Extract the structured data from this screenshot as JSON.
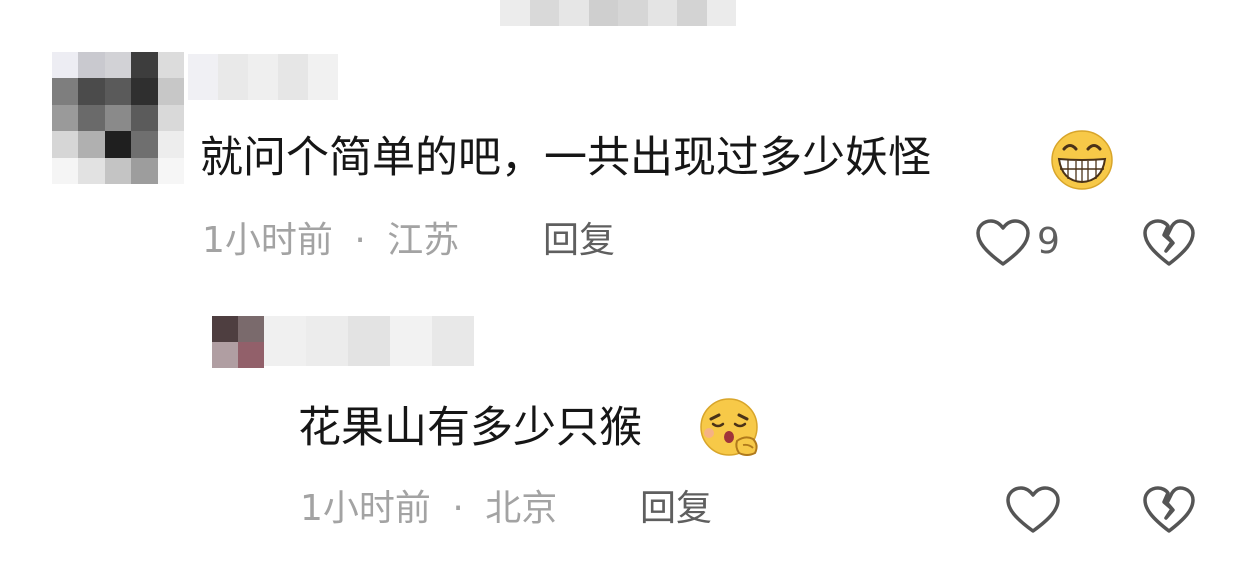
{
  "top_blurred_text": {
    "colors": [
      "#ececec",
      "#d9d9d9",
      "#e6e6e6",
      "#cfcfcf",
      "#d6d6d6",
      "#e4e4e4",
      "#d3d3d3",
      "#ebebeb"
    ]
  },
  "comment": {
    "avatar": {
      "colors": [
        "#ededf3",
        "#c9c9cf",
        "#d2d2d6",
        "#3d3d3d",
        "#dcdcdc",
        "#7e7e7e",
        "#4b4b4b",
        "#5a5a5a",
        "#2f2f2f",
        "#c7c7c7",
        "#9a9a9a",
        "#6a6a6a",
        "#8a8a8a",
        "#5b5b5b",
        "#d9d9d9",
        "#d6d6d6",
        "#b0b0b0",
        "#1f1f1f",
        "#6f6f6f",
        "#ededed",
        "#f5f5f5",
        "#e2e2e2",
        "#c4c4c4",
        "#9d9d9d",
        "#f6f6f6"
      ]
    },
    "username_blur": {
      "colors": [
        "#f0f0f4",
        "#e9e9e9",
        "#efefef",
        "#e6e6e6",
        "#f1f1f1"
      ]
    },
    "text": "就问个简单的吧，一共出现过多少妖怪",
    "emoji": "grinning-face-emoji",
    "time": "1小时前",
    "separator": "·",
    "location": "江苏",
    "reply_label": "回复",
    "like_count": "9"
  },
  "reply": {
    "avatar": {
      "colors": [
        "#4e3e40",
        "#7a6a6c",
        "#b09ea2",
        "#92606a"
      ]
    },
    "username_blur": {
      "colors": [
        "#f0f0f0",
        "#ececec",
        "#e3e3e3",
        "#f2f2f2",
        "#e8e8e8"
      ]
    },
    "text": "花果山有多少只猴",
    "emoji": "shushing-face-emoji",
    "time": "1小时前",
    "separator": "·",
    "location": "北京",
    "reply_label": "回复"
  },
  "colors": {
    "text_primary": "#161616",
    "text_meta": "#a3a3a3",
    "reply_label": "#5f5f5f",
    "icon": "#555555",
    "emoji_yellow": "#f7c948"
  }
}
